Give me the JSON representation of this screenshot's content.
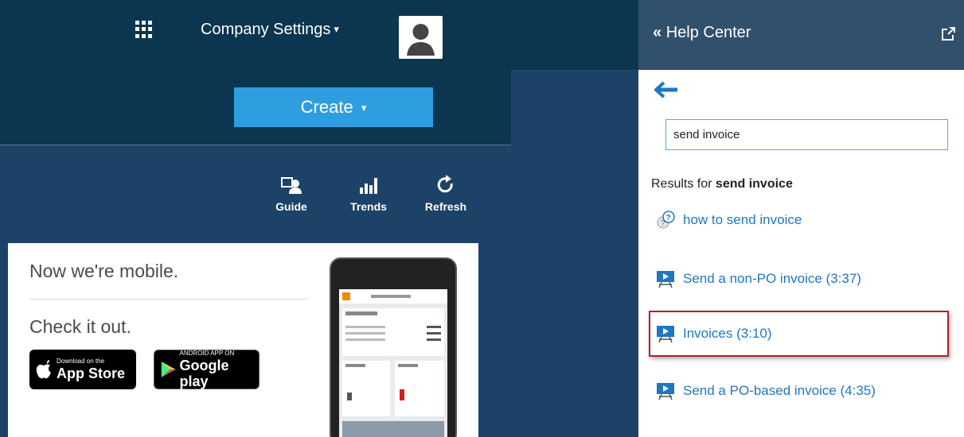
{
  "header": {
    "apps_icon": "grid-icon",
    "company_settings": "Company Settings",
    "caret": "▾"
  },
  "create": {
    "label": "Create",
    "caret": "▾"
  },
  "toolbar": [
    {
      "label": "Guide",
      "icon": "guide-icon"
    },
    {
      "label": "Trends",
      "icon": "trends-icon"
    },
    {
      "label": "Refresh",
      "icon": "refresh-icon"
    }
  ],
  "promo": {
    "headline": "Now we're mobile.",
    "subline": "Check it out.",
    "app_store": {
      "small": "Download on the",
      "big": "App Store"
    },
    "google_play": {
      "small": "ANDROID APP ON",
      "big": "Google play"
    }
  },
  "help": {
    "title": "Help Center",
    "collapse_icon": "double-chevron-left-icon",
    "popout_icon": "external-link-icon",
    "search_value": "send invoice",
    "results_prefix": "Results for",
    "results_query": "send invoice",
    "results": [
      {
        "label": "how to send invoice",
        "type": "question"
      },
      {
        "label": "Send a non-PO invoice (3:37)",
        "type": "video"
      },
      {
        "label": "Invoices (3:10)",
        "type": "video",
        "highlighted": true
      },
      {
        "label": "Send a PO-based invoice (4:35)",
        "type": "video"
      }
    ]
  },
  "colors": {
    "topbar": "#0c3650",
    "background": "#1d4268",
    "create_button": "#2e9ee0",
    "help_header": "#31506b",
    "link": "#1f77c2",
    "highlight_border": "#a8242c"
  }
}
